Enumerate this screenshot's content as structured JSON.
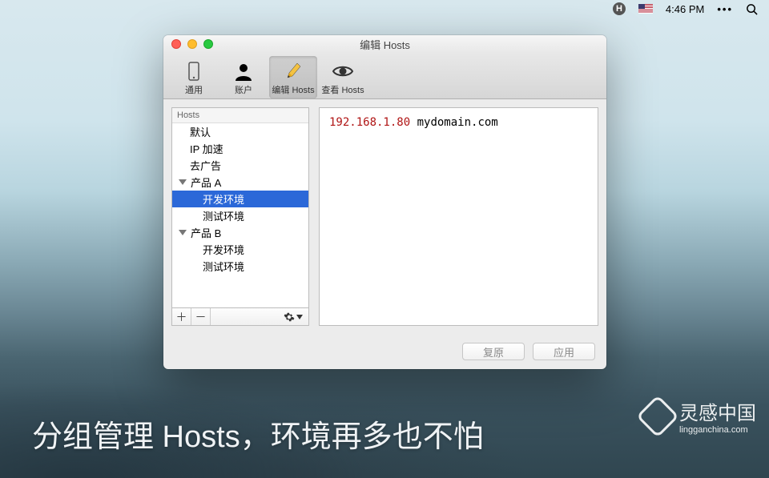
{
  "menubar": {
    "app_letter": "H",
    "clock": "4:46 PM"
  },
  "window": {
    "title": "编辑 Hosts"
  },
  "toolbar": {
    "items": [
      {
        "label": "通用"
      },
      {
        "label": "账户"
      },
      {
        "label": "编辑 Hosts"
      },
      {
        "label": "查看 Hosts"
      }
    ]
  },
  "sidebar": {
    "header": "Hosts",
    "rows": [
      {
        "label": "默认",
        "level": 1,
        "group": false,
        "selected": false
      },
      {
        "label": "IP 加速",
        "level": 1,
        "group": false,
        "selected": false
      },
      {
        "label": "去广告",
        "level": 1,
        "group": false,
        "selected": false
      },
      {
        "label": "产品 A",
        "level": 0,
        "group": true,
        "selected": false
      },
      {
        "label": "开发环境",
        "level": 2,
        "group": false,
        "selected": true
      },
      {
        "label": "测试环境",
        "level": 2,
        "group": false,
        "selected": false
      },
      {
        "label": "产品 B",
        "level": 0,
        "group": true,
        "selected": false
      },
      {
        "label": "开发环境",
        "level": 2,
        "group": false,
        "selected": false
      },
      {
        "label": "测试环境",
        "level": 2,
        "group": false,
        "selected": false
      }
    ]
  },
  "editor": {
    "ip": "192.168.1.80",
    "host": "mydomain.com"
  },
  "buttons": {
    "revert": "复原",
    "apply": "应用"
  },
  "caption": "分组管理 Hosts，环境再多也不怕",
  "watermark": {
    "cn": "灵感中国",
    "en": "lingganchina.com"
  }
}
